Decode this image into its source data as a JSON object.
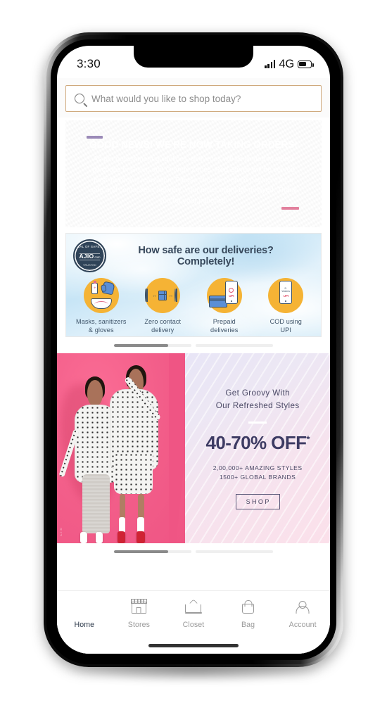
{
  "status_bar": {
    "time": "3:30",
    "network": "4G",
    "signal_icon": "signal-bars-icon",
    "battery_icon": "battery-icon"
  },
  "search": {
    "placeholder": "What would you like to shop today?",
    "value": "",
    "icon": "search-icon"
  },
  "notice_banner": {
    "heading": "GOOD NEWS! WE'RE NOW TAKING ORDERS!",
    "body": "As per government guidelines, deliveries will be limited to select pincodes in Green and Orange Zones. Red Zones will be served post lockdown relaxation. Please choose prepaid payment for a safe and contactless delivery. Your order might be delayed. Thank you for your patience!",
    "gradient_from": "#ee72b2",
    "gradient_to": "#4b93d8"
  },
  "safety_banner": {
    "seal": {
      "top_text": "SEAL OF SAFETY",
      "brand": "AJIO",
      "brand_suffix": ".com",
      "bottom_text": "TRUSTED"
    },
    "heading": "How safe are our deliveries? Completely!",
    "accent_color": "#f5b335",
    "features": [
      {
        "icon": "mask-sanitizer-gloves-icon",
        "label": "Masks, sanitizers\n& gloves"
      },
      {
        "icon": "zero-contact-delivery-icon",
        "label": "Zero contact\ndelivery"
      },
      {
        "icon": "prepaid-deliveries-icon",
        "label": "Prepaid\ndeliveries"
      },
      {
        "icon": "cod-upi-icon",
        "label": "COD using\nUPI"
      }
    ]
  },
  "pagination": {
    "segments": 2,
    "active_index": 0,
    "active_fill_percent": 70
  },
  "promo_banner": {
    "tagline_line1": "Get Groovy With",
    "tagline_line2": "Our Refreshed Styles",
    "offer": "40-70% OFF",
    "offer_asterisk": "*",
    "detail_line1": "2,00,000+ AMAZING STYLES",
    "detail_line2": "1500+ GLOBAL BRANDS",
    "cta_label": "SHOP",
    "photo_bg_color": "#ef5584"
  },
  "bottom_nav": {
    "active_color": "#2f3b4c",
    "inactive_color": "#9a9a9a",
    "items": [
      {
        "label": "Home",
        "icon": "ajio-home-logo-icon",
        "active": true
      },
      {
        "label": "Stores",
        "icon": "storefront-icon",
        "active": false
      },
      {
        "label": "Closet",
        "icon": "hanger-icon",
        "active": false
      },
      {
        "label": "Bag",
        "icon": "shopping-bag-icon",
        "active": false
      },
      {
        "label": "Account",
        "icon": "person-icon",
        "active": false
      }
    ]
  }
}
